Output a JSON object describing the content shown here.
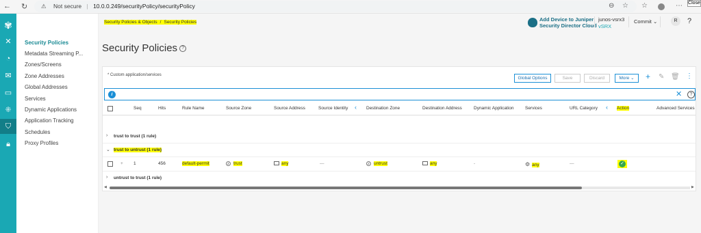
{
  "browser": {
    "security_label": "Not secure",
    "url": "10.0.0.249/securityPolicy/securityPolicy",
    "close_tooltip": "Close"
  },
  "rail": {
    "icons": [
      "logo-icon",
      "close-icon",
      "dashboard-icon",
      "monitor-icon",
      "devices-icon",
      "network-icon",
      "shared-services-icon",
      "security-policy-icon",
      "admin-icon"
    ]
  },
  "subnav": {
    "items": [
      "Security Policies",
      "Metadata Streaming P...",
      "Zones/Screens",
      "Zone Addresses",
      "Global Addresses",
      "Services",
      "Dynamic Applications",
      "Application Tracking",
      "Schedules",
      "Proxy Profiles"
    ],
    "active_index": 0
  },
  "header": {
    "breadcrumb_parent": "Security Policies & Objects",
    "breadcrumb_sep": "/",
    "breadcrumb_current": "Security Policies",
    "cloud_line1": "Add Device to Juniper",
    "cloud_line2": "Security Director Cloud",
    "device_name": "junos-vsrx3",
    "device_type": "vSRX",
    "commit_label": "Commit",
    "user_initial": "R",
    "help_label": "?"
  },
  "page": {
    "title": "Security Policies"
  },
  "grid": {
    "note": "* Custom application/services",
    "buttons": {
      "global_options": "Global Options",
      "save": "Save",
      "discard": "Discard",
      "more": "More"
    },
    "columns": [
      "Seq",
      "Hits",
      "Rule Name",
      "Source Zone",
      "Source Address",
      "Source Identity",
      "Destination Zone",
      "Destination Address",
      "Dynamic Application",
      "Services",
      "URL Category",
      "Action",
      "Advanced Services"
    ],
    "groups": [
      {
        "label": "trust to trust (1 rule)",
        "expanded": false
      },
      {
        "label": "trust to untrust (1 rule)",
        "expanded": true
      },
      {
        "label": "untrust to trust (1 rule)",
        "expanded": false
      }
    ],
    "rule": {
      "expand": "+",
      "seq": "1",
      "hits": "456",
      "rule_name": "default-permit",
      "source_zone": "trust",
      "source_address": "any",
      "source_identity": "—",
      "destination_zone": "untrust",
      "destination_address": "any",
      "dynamic_application": "-",
      "services": "any",
      "url_category": "—",
      "action": "permit"
    }
  },
  "colors": {
    "rail": "#1aa8b4",
    "accent": "#1a8fd6",
    "highlight": "#ffff00",
    "permit": "#36a84a"
  }
}
